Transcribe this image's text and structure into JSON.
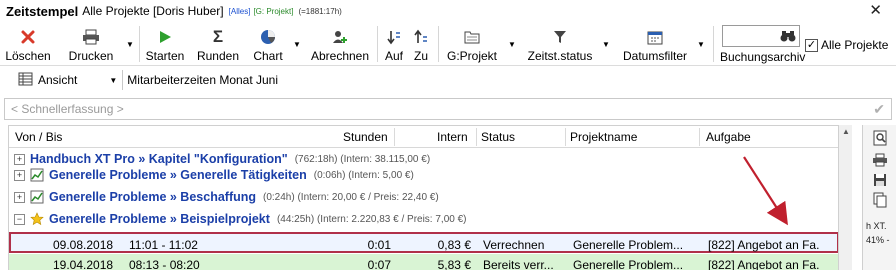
{
  "window": {
    "title": "Zeitstempel",
    "subtitle": "Alle Projekte [Doris Huber]",
    "tag_all": "[Alles]",
    "tag_project": "[G: Projekt]",
    "total": "(=1881:17h)",
    "close_glyph": "✕"
  },
  "toolbar": {
    "loeschen": "Löschen",
    "drucken": "Drucken",
    "starten": "Starten",
    "runden": "Runden",
    "chart": "Chart",
    "abrechnen": "Abrechnen",
    "auf": "Auf",
    "zu": "Zu",
    "g_projekt": "G:Projekt",
    "zeitst_status": "Zeitst.status",
    "datumsfilter": "Datumsfilter",
    "buchungsarchiv": "Buchungsarchiv",
    "search_value": "",
    "alle_projekte": "Alle Projekte",
    "alle_projekte_checked": "✓",
    "caret": "▼"
  },
  "viewbar": {
    "ansicht": "Ansicht",
    "caret": "▼",
    "report_title": "Mitarbeiterzeiten Monat Juni"
  },
  "quick_entry": {
    "placeholder": "< Schnellerfassung >",
    "ok_glyph": "✔"
  },
  "grid": {
    "columns": {
      "von_bis": "Von / Bis",
      "stunden": "Stunden",
      "intern": "Intern",
      "status": "Status",
      "projektname": "Projektname",
      "aufgabe": "Aufgabe"
    },
    "groups": [
      {
        "expander": "+",
        "name": "Handbuch XT Pro » Kapitel \"Konfiguration\"",
        "info": "(762:18h) (Intern: 38.115,00 €)"
      },
      {
        "expander": "+",
        "name": "Generelle Probleme » Generelle Tätigkeiten",
        "info": "(0:06h) (Intern: 5,00 €)"
      },
      {
        "expander": "+",
        "name": "Generelle Probleme » Beschaffung",
        "info": "(0:24h) (Intern: 20,00 € / Preis: 22,40 €)"
      },
      {
        "expander": "−",
        "name": "Generelle Probleme » Beispielprojekt",
        "info": "(44:25h) (Intern: 2.220,83 € / Preis: 7,00 €)"
      }
    ],
    "rows": [
      {
        "date": "09.08.2018",
        "time": "11:01 - 11:02",
        "stunden": "0:01",
        "intern": "0,83 €",
        "status": "Verrechnen",
        "projekt": "Generelle Problem...",
        "aufgabe": "[822] Angebot an Fa."
      },
      {
        "date": "19.04.2018",
        "time": "08:13 - 08:20",
        "stunden": "0:07",
        "intern": "5,83 €",
        "status": "Bereits verr...",
        "projekt": "Generelle Problem...",
        "aufgabe": "[822] Angebot an Fa."
      }
    ]
  },
  "side_panel": {
    "label_1": "h XT.",
    "label_2": "41% -"
  },
  "colors": {
    "group_text": "#1b3fa8",
    "highlight_border": "#b0304a",
    "arrow": "#c0202e",
    "row_green": "#d9f4d4"
  }
}
